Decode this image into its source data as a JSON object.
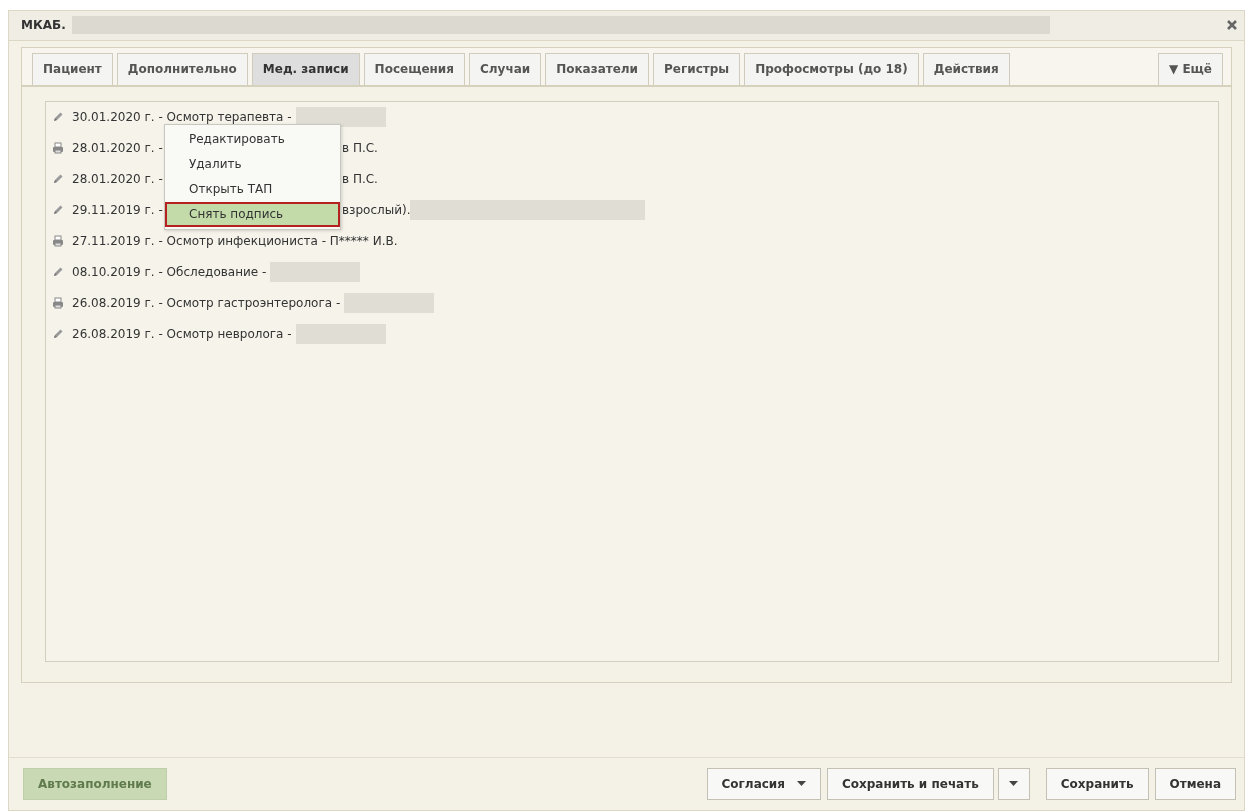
{
  "window": {
    "title": "МКАБ.",
    "title_redacted": true
  },
  "tabs": [
    {
      "label": "Пациент",
      "selected": false
    },
    {
      "label": "Дополнительно",
      "selected": false
    },
    {
      "label": "Мед. записи",
      "selected": true
    },
    {
      "label": "Посещения",
      "selected": false
    },
    {
      "label": "Случаи",
      "selected": false
    },
    {
      "label": "Показатели",
      "selected": false
    },
    {
      "label": "Регистры",
      "selected": false
    },
    {
      "label": "Профосмотры (до 18)",
      "selected": false
    },
    {
      "label": "Действия",
      "selected": false
    }
  ],
  "more_tab": {
    "label": "▼ Ещё"
  },
  "records": [
    {
      "kind": "edit",
      "text": "30.01.2020 г. - Осмотр терапевта -",
      "redacted": true
    },
    {
      "kind": "print",
      "text": "28.01.2020 г. -",
      "tail": "в П.С.",
      "redacted": false
    },
    {
      "kind": "edit",
      "text": "28.01.2020 г. -",
      "tail": "в П.С.",
      "redacted": false
    },
    {
      "kind": "edit",
      "text": "29.11.2019 г. -",
      "tail": "взрослый).",
      "redacted": true
    },
    {
      "kind": "print",
      "text": "27.11.2019 г. - Осмотр инфекциониста - П***** И.В.",
      "redacted": false
    },
    {
      "kind": "edit",
      "text": "08.10.2019 г. - Обследование -",
      "redacted": true
    },
    {
      "kind": "print",
      "text": "26.08.2019 г. - Осмотр гастроэнтеролога -",
      "redacted": true
    },
    {
      "kind": "edit",
      "text": "26.08.2019 г. - Осмотр невролога -",
      "redacted": true
    }
  ],
  "context_menu": [
    {
      "label": "Редактировать",
      "selected": false
    },
    {
      "label": "Удалить",
      "selected": false
    },
    {
      "label": "Открыть ТАП",
      "selected": false
    },
    {
      "label": "Снять подпись",
      "selected": true
    }
  ],
  "footer": {
    "autofill": {
      "label": "Автозаполнение",
      "disabled": true
    },
    "buttons": [
      {
        "label": "Согласия",
        "kind": "dropdown"
      },
      {
        "label": "Сохранить и печать",
        "kind": "split"
      },
      {
        "label": "Сохранить",
        "kind": "plain"
      },
      {
        "label": "Отмена",
        "kind": "plain"
      }
    ]
  }
}
